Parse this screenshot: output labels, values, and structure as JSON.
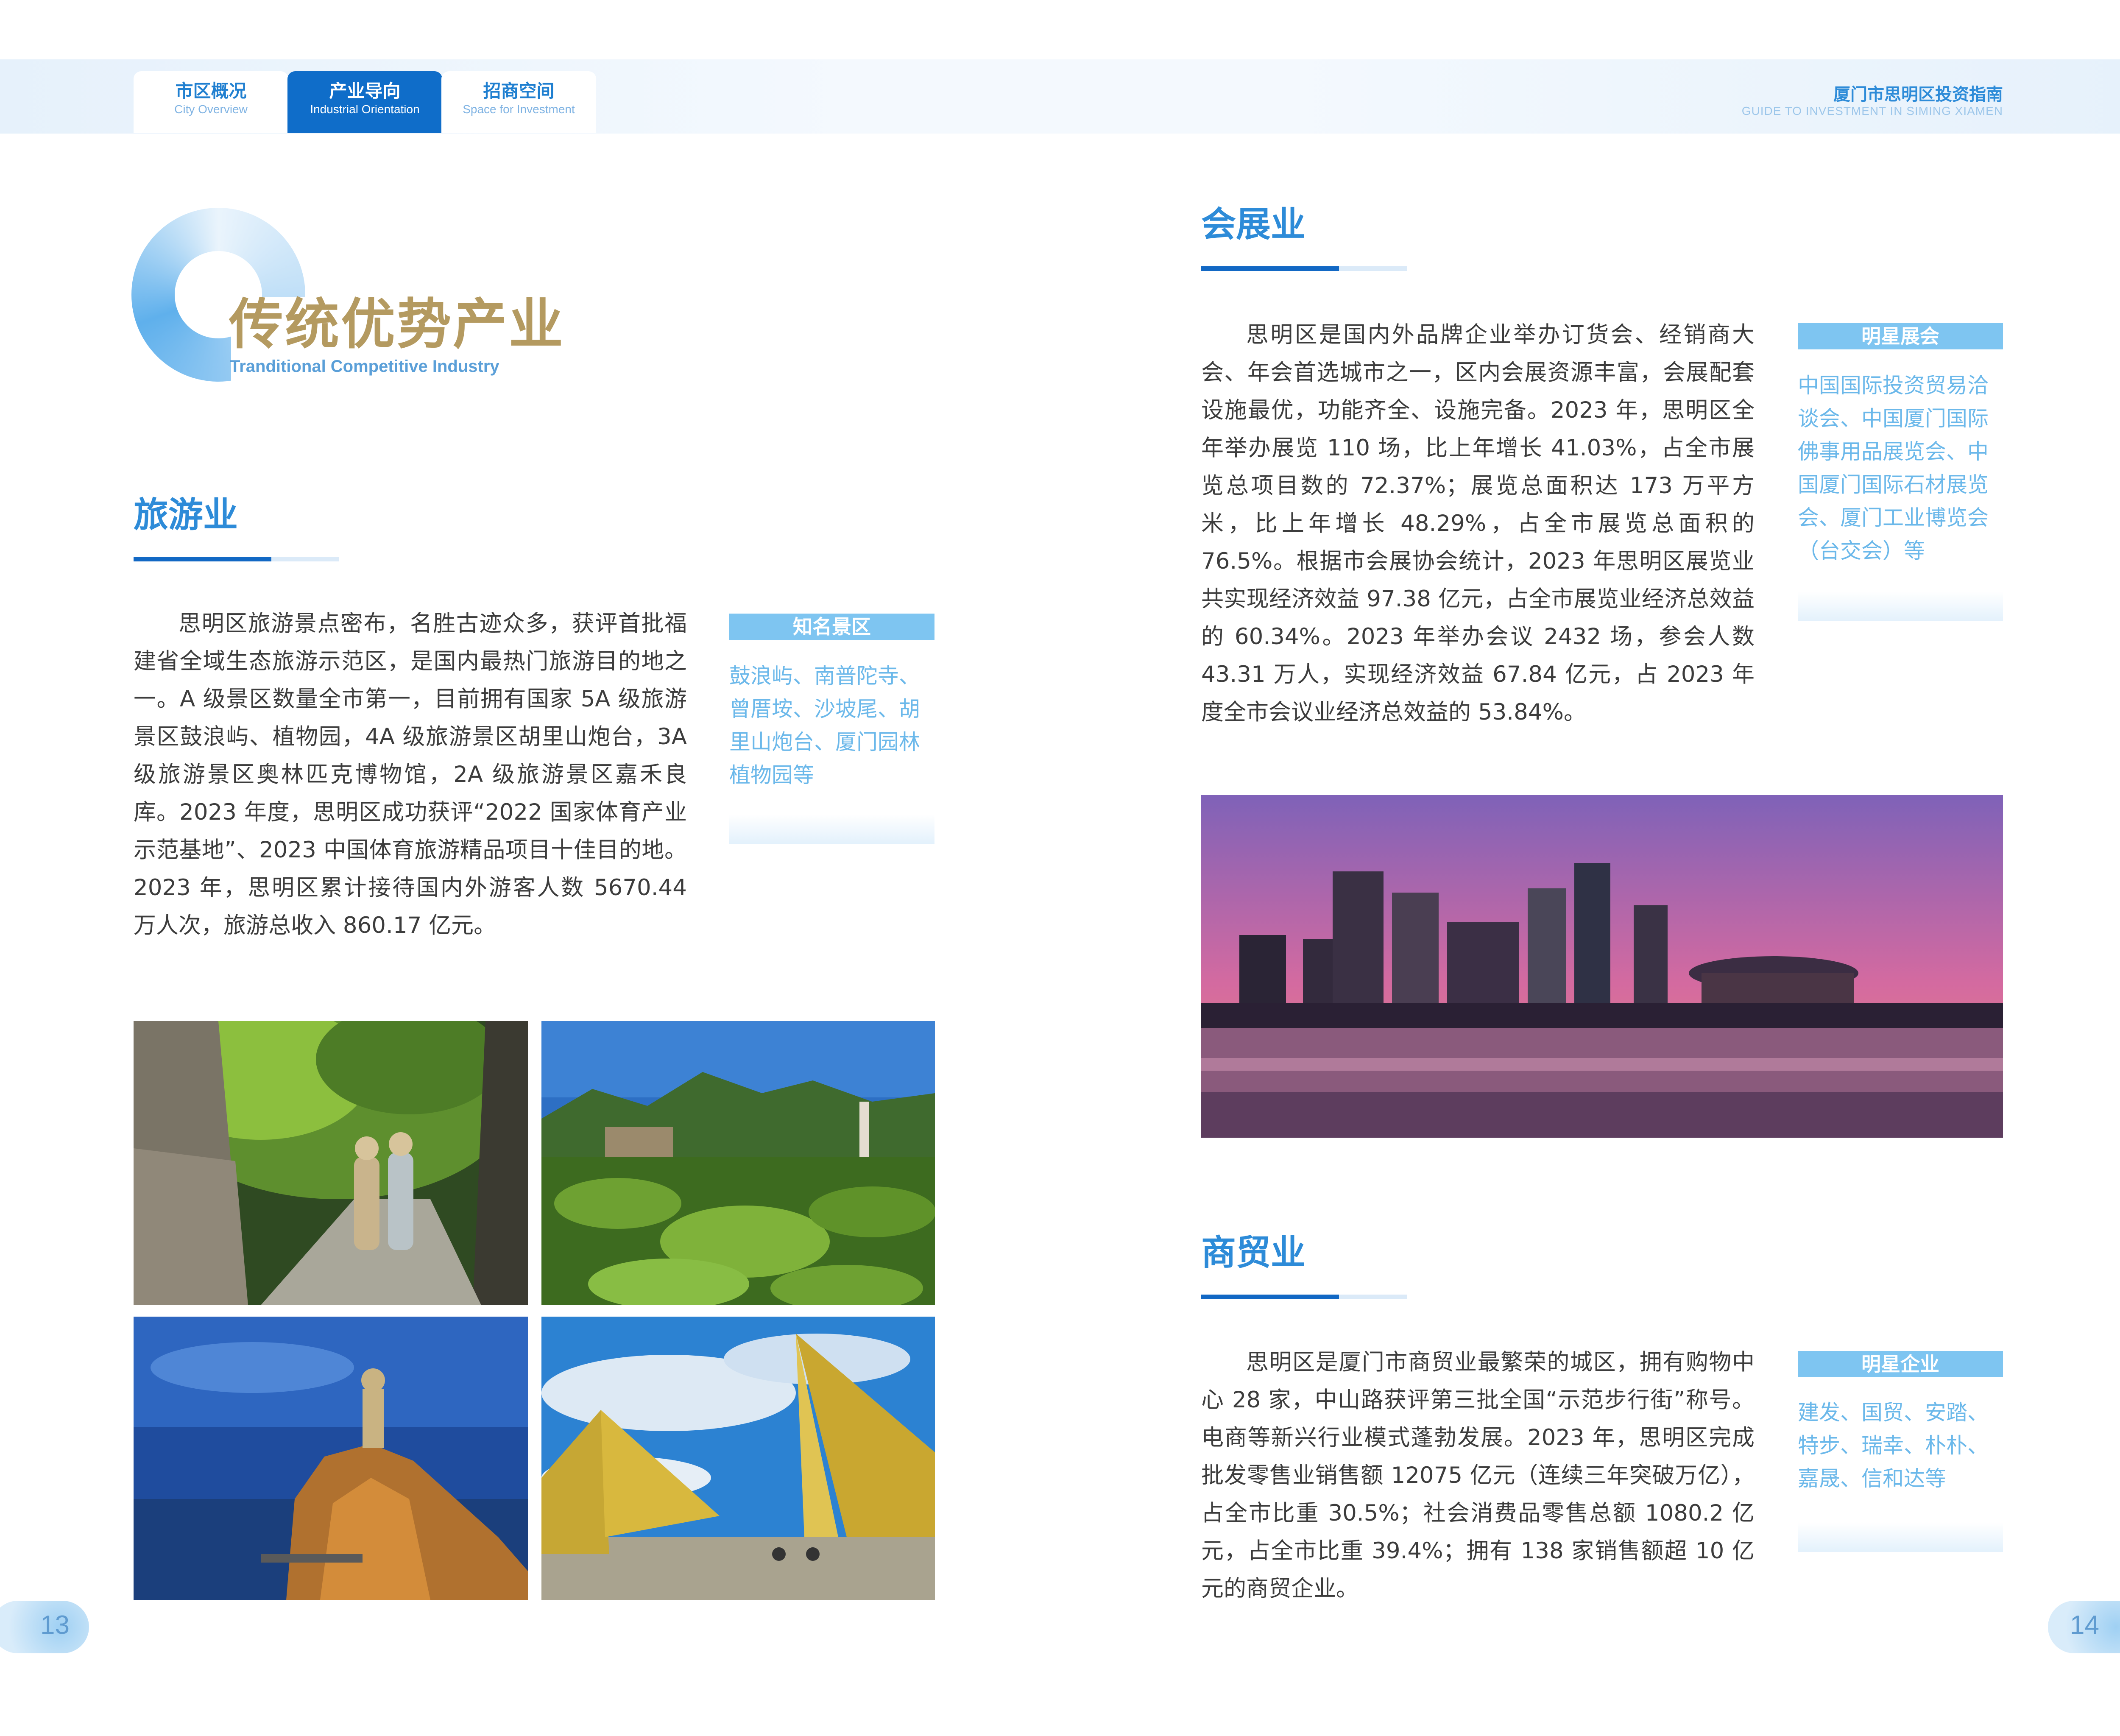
{
  "nav": {
    "tabs": [
      {
        "cn": "市区概况",
        "en": "City Overview"
      },
      {
        "cn": "产业导向",
        "en": "Industrial Orientation"
      },
      {
        "cn": "招商空间",
        "en": "Space for Investment"
      }
    ],
    "active_tab": 1
  },
  "brand": {
    "title_cn": "厦门市思明区投资指南",
    "title_en": "GUIDE TO INVESTMENT IN SIMING XIAMEN"
  },
  "section": {
    "title_cn": "传统优势产业",
    "title_en": "Tranditional Competitive Industry"
  },
  "tourism": {
    "heading": "旅游业",
    "body": "思明区旅游景点密布，名胜古迹众多，获评首批福建省全域生态旅游示范区，是国内最热门旅游目的地之一。A 级景区数量全市第一，目前拥有国家 5A 级旅游景区鼓浪屿、植物园，4A 级旅游景区胡里山炮台，3A 级旅游景区奥林匹克博物馆，2A 级旅游景区嘉禾良库。2023 年度，思明区成功获评“2022 国家体育产业示范基地”、2023 中国体育旅游精品项目十佳目的地。2023 年，思明区累计接待国内外游客人数 5670.44 万人次，旅游总收入 860.17 亿元。",
    "tag": "知名景区",
    "tag_text": "鼓浪屿、南普陀寺、曾厝垵、沙坡尾、胡里山炮台、厦门园林植物园等"
  },
  "exhibition": {
    "heading": "会展业",
    "body": "思明区是国内外品牌企业举办订货会、经销商大会、年会首选城市之一，区内会展资源丰富，会展配套设施最优，功能齐全、设施完备。2023 年，思明区全年举办展览 110 场，比上年增长 41.03%，占全市展览总项目数的 72.37%；展览总面积达 173 万平方米，比上年增长 48.29%，占全市展览总面积的 76.5%。根据市会展协会统计，2023 年思明区展览业共实现经济效益 97.38 亿元，占全市展览业经济总效益的 60.34%。2023 年举办会议 2432 场，参会人数 43.31 万人，实现经济效益 67.84 亿元，占 2023 年度全市会议业经济总效益的 53.84%。",
    "tag": "明星展会",
    "tag_text": "中国国际投资贸易洽谈会、中国厦门国际佛事用品展览会、中国厦门国际石材展览会、厦门工业博览会（台交会）等"
  },
  "commerce": {
    "heading": "商贸业",
    "body": "思明区是厦门市商贸业最繁荣的城区，拥有购物中心 28 家，中山路获评第三批全国“示范步行街”称号。电商等新兴行业模式蓬勃发展。2023 年，思明区完成批发零售业销售额 12075 亿元（连续三年突破万亿），占全市比重 30.5%；社会消费品零售总额 1080.2 亿元，占全市比重 39.4%；拥有 138 家销售额超 10 亿元的商贸企业。",
    "tag": "明星企业",
    "tag_text": "建发、国贸、安踏、特步、瑞幸、朴朴、嘉晟、信和达等"
  },
  "pages": {
    "left": "13",
    "right": "14"
  },
  "colors": {
    "brand_blue": "#0f6dc9",
    "heading_blue": "#2d8bd8",
    "gold": "#b49a60",
    "tag_blue": "#7ec5f1"
  }
}
